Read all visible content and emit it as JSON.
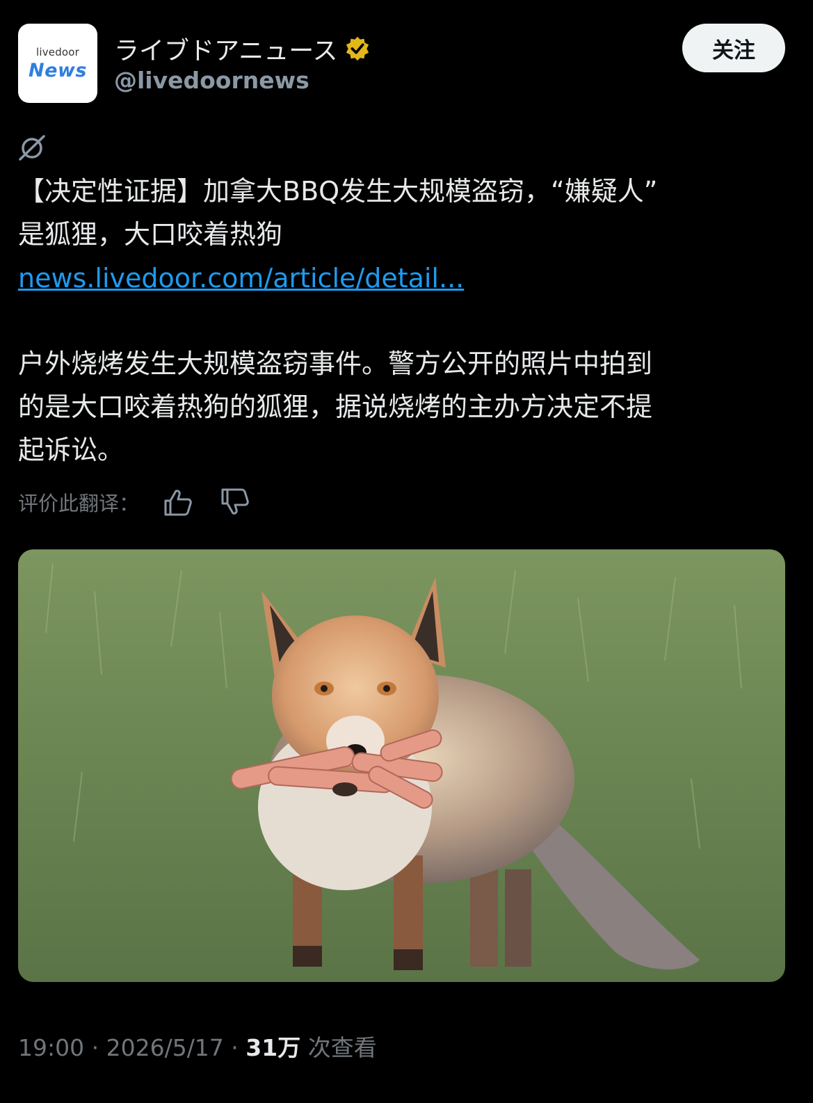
{
  "account": {
    "avatar_small": "livedoor",
    "avatar_big": "News",
    "display_name": "ライブドアニュース",
    "handle": "@livedoornews",
    "verified_color": "#e2b719",
    "follow_label": "关注"
  },
  "post": {
    "title_lines": [
      "【决定性证据】加拿大BBQ发生大规模盗窃，“嫌疑人”",
      "是狐狸，大口咬着热狗"
    ],
    "link": "news.livedoor.com/article/detail...",
    "desc_lines": [
      "户外烧烤发生大规模盗窃事件。警方公开的照片中拍到",
      "的是大口咬着热狗的狐狸，据说烧烤的主办方决定不提",
      "起诉讼。"
    ],
    "rate_label": "评价此翻译：",
    "icons": [
      "translate-icon",
      "thumbs-up-icon",
      "thumbs-down-icon"
    ]
  },
  "meta": {
    "time": "19:00",
    "sep1": " · ",
    "date": "2026/5/17",
    "sep2": " · ",
    "views_count": "31万",
    "views_label": " 次查看"
  },
  "colors": {
    "background": "#000000",
    "text": "#e7e9ea",
    "muted": "#71767b",
    "link": "#1d9bf0"
  }
}
